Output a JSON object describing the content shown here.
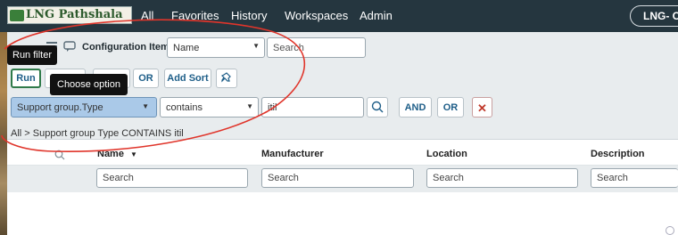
{
  "brand": {
    "logo_text": "LNG Pathshala"
  },
  "nav": {
    "items": [
      "All",
      "Favorites",
      "History",
      "Workspaces",
      "Admin"
    ],
    "instance_pill": "LNG- C"
  },
  "filter_bar": {
    "list_label": "Configuration Items",
    "field_select": "Name",
    "search_placeholder": "Search",
    "run_filter_tooltip": "Run filter",
    "run_label": "Run",
    "choose_option_tooltip": "Choose option",
    "or_label": "OR",
    "add_sort_label": "Add Sort",
    "condition": {
      "field": "Support group.Type",
      "operator": "contains",
      "value": "itil"
    },
    "and_label": "AND",
    "or2_label": "OR",
    "breadcrumb": "All > Support group Type CONTAINS itil"
  },
  "table": {
    "columns": [
      {
        "label": "Name",
        "sorted": "desc"
      },
      {
        "label": "Manufacturer"
      },
      {
        "label": "Location"
      },
      {
        "label": "Description"
      }
    ],
    "search_placeholder": "Search"
  },
  "annotation": {
    "color": "#e0352b",
    "shape": "hand-drawn ellipse"
  }
}
